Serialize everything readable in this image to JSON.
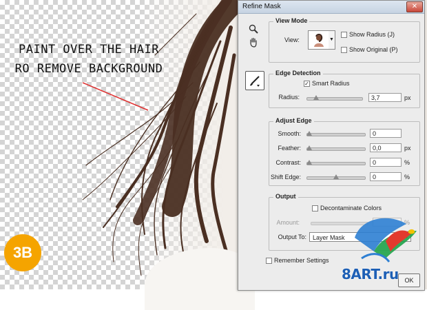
{
  "overlay": {
    "caption_line1": "PAINT OVER THE HAIR",
    "caption_line2": "RO REMOVE BACKGROUND",
    "step_badge": "3B",
    "accent_color": "#f5a400",
    "pointer_color": "#e03030"
  },
  "dialog": {
    "title": "Refine Mask",
    "close_label": "✕",
    "tools": [
      "zoom-icon",
      "hand-icon",
      "refine-radius-brush-icon"
    ],
    "view_mode": {
      "title": "View Mode",
      "view_label": "View:",
      "show_radius_label": "Show Radius (J)",
      "show_original_label": "Show Original (P)",
      "show_radius_checked": false,
      "show_original_checked": false
    },
    "edge_detection": {
      "title": "Edge Detection",
      "smart_radius_label": "Smart Radius",
      "smart_radius_checked": true,
      "radius_label": "Radius:",
      "radius_value": "3,7",
      "radius_unit": "px"
    },
    "adjust_edge": {
      "title": "Adjust Edge",
      "smooth_label": "Smooth:",
      "smooth_value": "0",
      "feather_label": "Feather:",
      "feather_value": "0,0",
      "feather_unit": "px",
      "contrast_label": "Contrast:",
      "contrast_value": "0",
      "contrast_unit": "%",
      "shift_label": "Shift Edge:",
      "shift_value": "0",
      "shift_unit": "%"
    },
    "output": {
      "title": "Output",
      "decontaminate_label": "Decontaminate Colors",
      "decontaminate_checked": false,
      "amount_label": "Amount:",
      "amount_unit": "%",
      "output_to_label": "Output To:",
      "output_to_value": "Layer Mask"
    },
    "remember_label": "Remember Settings",
    "remember_checked": false,
    "ok_label": "OK"
  },
  "watermark": {
    "text": "8ART.ru",
    "color": "#1d5fb5"
  }
}
